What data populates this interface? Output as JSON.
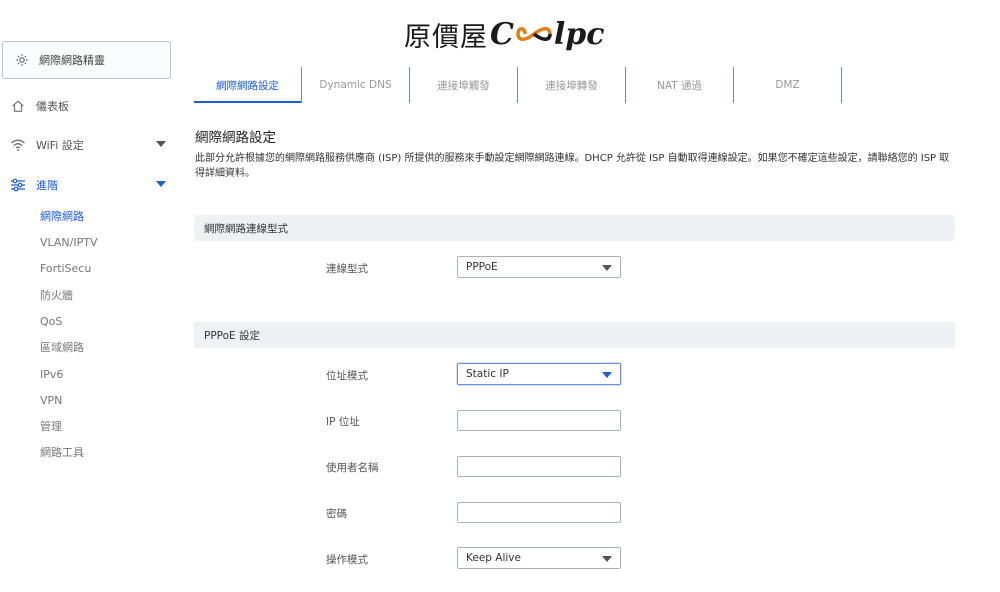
{
  "logo": {
    "cn": "原價屋",
    "en_prefix": "C",
    "en_suffix": "lpc"
  },
  "sidebar": {
    "wizard": {
      "label": "網際網路精靈",
      "icon": "gear-icon"
    },
    "dashboard": {
      "label": "儀表板",
      "icon": "home-icon"
    },
    "wifi": {
      "label": "WiFi 設定",
      "icon": "wifi-icon"
    },
    "advanced": {
      "label": "進階",
      "icon": "sliders-icon"
    },
    "sub_items": [
      "網際網路",
      "VLAN/IPTV",
      "FortiSecu",
      "防火牆",
      "QoS",
      "區域網路",
      "IPv6",
      "VPN",
      "管理",
      "網路工具"
    ]
  },
  "tabs": [
    "網際網路設定",
    "Dynamic DNS",
    "連接埠觸發",
    "連接埠轉發",
    "NAT 通過",
    "DMZ"
  ],
  "main": {
    "title": "網際網路設定",
    "description": "此部分允許根據您的網際網路服務供應商 (ISP) 所提供的服務來手動設定網際網路連線。DHCP 允許從 ISP 自動取得連線設定。如果您不確定這些設定，請聯絡您的 ISP 取得詳細資料。",
    "section_connection": "網際網路連線型式",
    "connection_type_label": "連線型式",
    "connection_type_value": "PPPoE",
    "section_pppoe": "PPPoE 設定",
    "address_mode_label": "位址模式",
    "address_mode_value": "Static IP",
    "ip_label": "IP 位址",
    "ip_value": "",
    "username_label": "使用者名稱",
    "username_value": "",
    "password_label": "密碼",
    "password_value": "",
    "operation_mode_label": "操作模式",
    "operation_mode_value": "Keep Alive"
  },
  "colors": {
    "accent": "#1c5fd1",
    "section_bg": "#eef0f3"
  }
}
